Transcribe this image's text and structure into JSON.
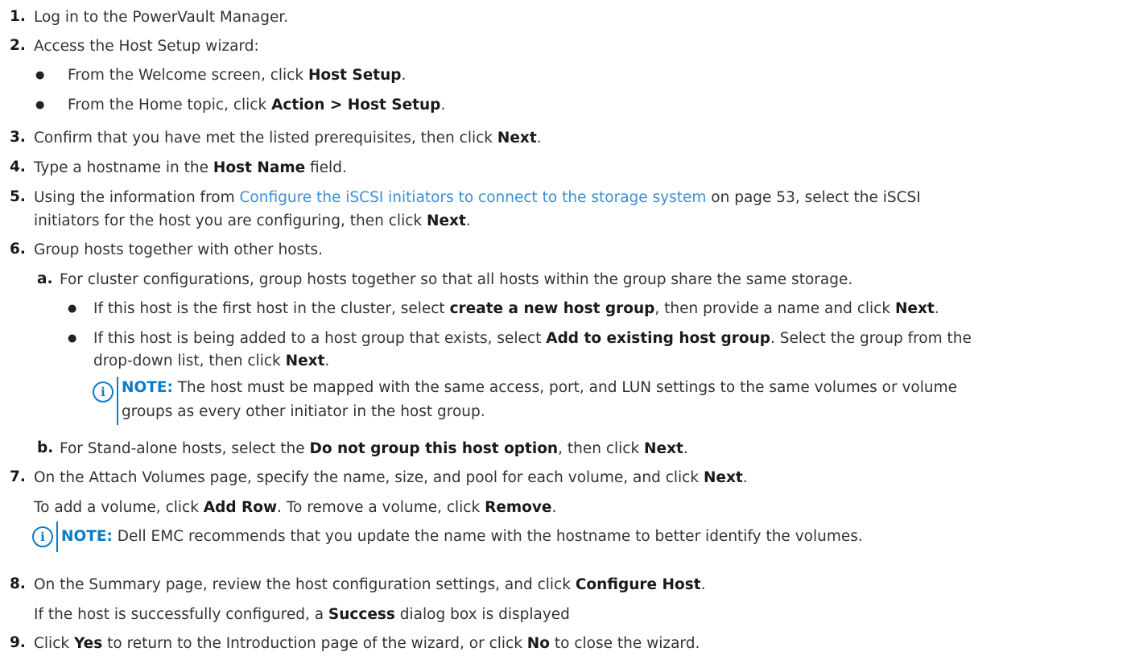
{
  "steps": {
    "s1": {
      "num": "1.",
      "text": "Log in to the PowerVault Manager."
    },
    "s2": {
      "num": "2.",
      "text": "Access the Host Setup wizard:"
    },
    "s2b1": {
      "pre": "From the Welcome screen, click ",
      "bold": "Host Setup",
      "post": "."
    },
    "s2b2": {
      "pre": "From the Home topic, click ",
      "bold": "Action > Host Setup",
      "post": "."
    },
    "s3": {
      "num": "3.",
      "pre": "Confirm that you have met the listed prerequisites, then click ",
      "bold": "Next",
      "post": "."
    },
    "s4": {
      "num": "4.",
      "pre": "Type a hostname in the ",
      "bold": "Host Name",
      "post": " field."
    },
    "s5": {
      "num": "5.",
      "pre": "Using the information from ",
      "link": "Configure the iSCSI initiators to connect to the storage system",
      "mid": " on page 53, select the iSCSI",
      "line2_pre": "initiators for the host you are configuring, then click ",
      "bold": "Next",
      "post": "."
    },
    "s6": {
      "num": "6.",
      "text": "Group hosts together with other hosts."
    },
    "s6a": {
      "num": "a.",
      "text": "For cluster configurations, group hosts together so that all hosts within the group share the same storage."
    },
    "s6a1": {
      "pre": "If this host is the first host in the cluster, select ",
      "bold": "create a new host group",
      "mid": ", then provide a name and click ",
      "bold2": "Next",
      "post": "."
    },
    "s6a2": {
      "pre": "If this host is being added to a host group that exists, select ",
      "bold": "Add to existing host group",
      "mid": ". Select the group from the",
      "line2_pre": "drop-down list, then click ",
      "bold2": "Next",
      "post": "."
    },
    "note1": {
      "label": "NOTE:",
      "line1": " The host must be mapped with the same access, port, and LUN settings to the same volumes or volume",
      "line2": "groups as every other initiator in the host group."
    },
    "s6b": {
      "num": "b.",
      "pre": "For Stand-alone hosts, select the ",
      "bold": "Do not group this host option",
      "mid": ", then click ",
      "bold2": "Next",
      "post": "."
    },
    "s7": {
      "num": "7.",
      "pre": "On the Attach Volumes page, specify the name, size, and pool for each volume, and click ",
      "bold": "Next",
      "post": "."
    },
    "s7sub": {
      "pre": "To add a volume, click ",
      "bold": "Add Row",
      "mid": ". To remove a volume, click ",
      "bold2": "Remove",
      "post": "."
    },
    "note2": {
      "label": "NOTE:",
      "text": " Dell EMC recommends that you update the name with the hostname to better identify the volumes."
    },
    "s8": {
      "num": "8.",
      "pre": "On the Summary page, review the host configuration settings, and click ",
      "bold": "Configure Host",
      "post": "."
    },
    "s8sub": {
      "pre": "If the host is successfully configured, a ",
      "bold": "Success",
      "post": " dialog box is displayed"
    },
    "s9": {
      "num": "9.",
      "pre": "Click ",
      "bold": "Yes",
      "mid": " to return to the Introduction page of the wizard, or click ",
      "bold2": "No",
      "post": " to close the wizard."
    }
  },
  "bullet_glyph": "●",
  "info_glyph": "i"
}
